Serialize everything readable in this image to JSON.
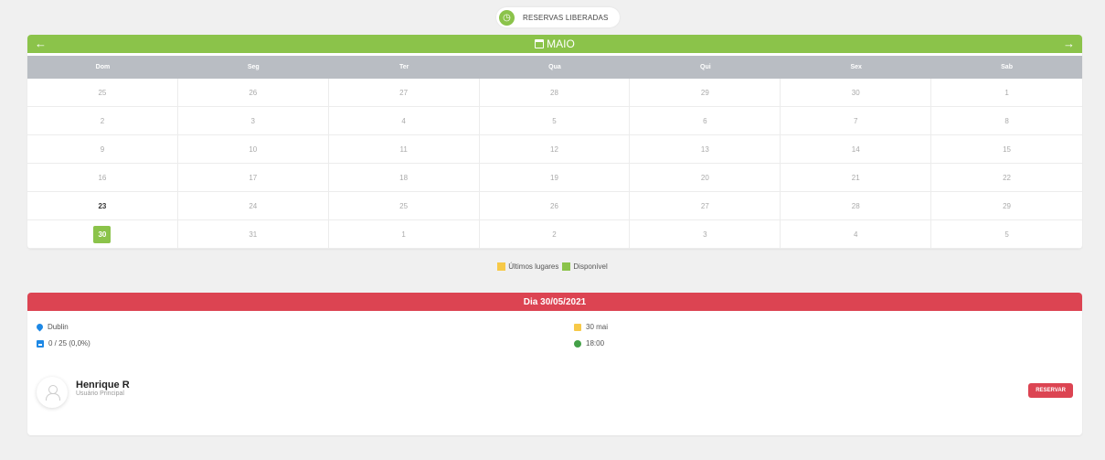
{
  "badge": {
    "icon": "clock-icon",
    "text": "RESERVAS LIBERADAS"
  },
  "calendar": {
    "month": "MAIO",
    "prev_icon": "arrow-left-icon",
    "next_icon": "arrow-right-icon",
    "weekdays": [
      "Dom",
      "Seg",
      "Ter",
      "Qua",
      "Qui",
      "Sex",
      "Sab"
    ],
    "weeks": [
      [
        "25",
        "26",
        "27",
        "28",
        "29",
        "30",
        "1"
      ],
      [
        "2",
        "3",
        "4",
        "5",
        "6",
        "7",
        "8"
      ],
      [
        "9",
        "10",
        "11",
        "12",
        "13",
        "14",
        "15"
      ],
      [
        "16",
        "17",
        "18",
        "19",
        "20",
        "21",
        "22"
      ],
      [
        "23",
        "24",
        "25",
        "26",
        "27",
        "28",
        "29"
      ],
      [
        "30",
        "31",
        "1",
        "2",
        "3",
        "4",
        "5"
      ]
    ],
    "highlight_day": "23",
    "selected_day": "30"
  },
  "legend": {
    "last_seats": "Últimos lugares",
    "available": "Disponível"
  },
  "colors": {
    "green": "#8bc34a",
    "red": "#dc4452",
    "yellow": "#f7c948",
    "blue": "#1e88e5"
  },
  "day": {
    "title": "Dia 30/05/2021",
    "location": "Dublin",
    "capacity": "0 / 25 (0,0%)",
    "date": "30 mai",
    "time": "18:00"
  },
  "user": {
    "name": "Henrique R",
    "role": "Usuário Principal"
  },
  "reserve_button": "RESERVAR"
}
